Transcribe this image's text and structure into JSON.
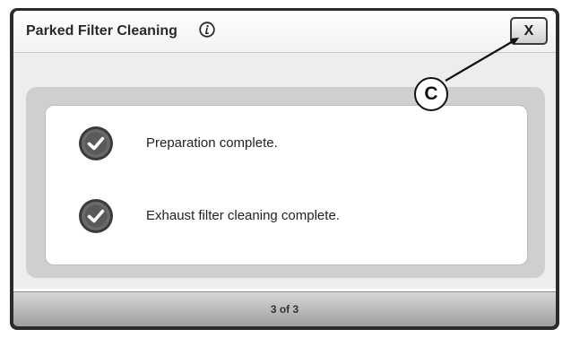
{
  "dialog": {
    "title": "Parked Filter Cleaning",
    "info_icon": "info-icon",
    "close_label": "X"
  },
  "steps": [
    {
      "label": "Preparation complete.",
      "icon": "check-circle-icon",
      "status": "complete"
    },
    {
      "label": "Exhaust filter cleaning complete.",
      "icon": "check-circle-icon",
      "status": "complete"
    }
  ],
  "footer": {
    "page_indicator": "3 of 3"
  },
  "callout": {
    "label": "C",
    "target": "close-button"
  },
  "colors": {
    "check_fill": "#555555",
    "titlebar": "#ffffff",
    "footer": "#b5b5b5",
    "frame": "#2b2b2b"
  }
}
